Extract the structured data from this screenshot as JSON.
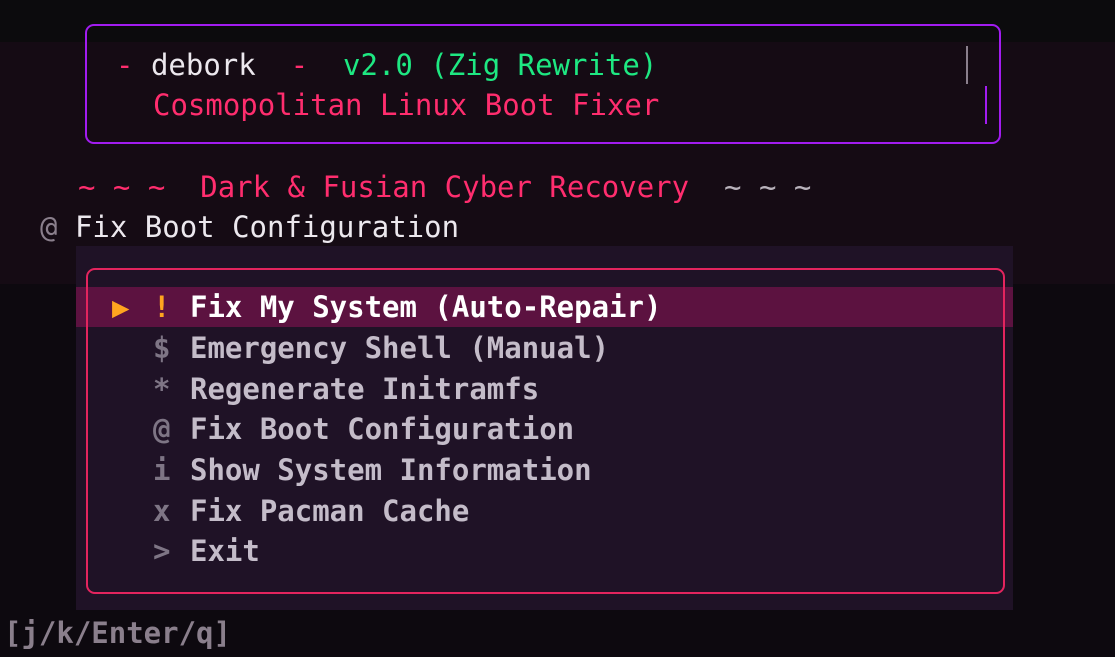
{
  "header": {
    "dash_left": "-",
    "app_name": "debork",
    "dash_right": "-",
    "version": "v2.0 (Zig Rewrite)",
    "subtitle": "Cosmopolitan Linux Boot Fixer"
  },
  "tagline": {
    "tilde_left": "~ ~ ~",
    "text": "Dark & Fusian Cyber Recovery",
    "tilde_right": "~ ~ ~"
  },
  "current": {
    "symbol": "@",
    "label": "Fix Boot Configuration"
  },
  "menu": {
    "pointer": "▶",
    "items": [
      {
        "symbol": "!",
        "label": "Fix My System (Auto-Repair)",
        "selected": true
      },
      {
        "symbol": "$",
        "label": "Emergency Shell (Manual)",
        "selected": false
      },
      {
        "symbol": "*",
        "label": "Regenerate Initramfs",
        "selected": false
      },
      {
        "symbol": "@",
        "label": "Fix Boot Configuration",
        "selected": false
      },
      {
        "symbol": "i",
        "label": "Show System Information",
        "selected": false
      },
      {
        "symbol": "x",
        "label": "Fix Pacman Cache",
        "selected": false
      },
      {
        "symbol": ">",
        "label": "Exit",
        "selected": false
      }
    ]
  },
  "footer": {
    "keys": "[j/k/Enter/q]"
  },
  "colors": {
    "header_border": "#a21cf0",
    "menu_border": "#e3245e",
    "accent_pink": "#ff2d6e",
    "accent_green": "#1ee882",
    "selection_bg": "#5c1240",
    "pointer": "#ffa51f"
  }
}
